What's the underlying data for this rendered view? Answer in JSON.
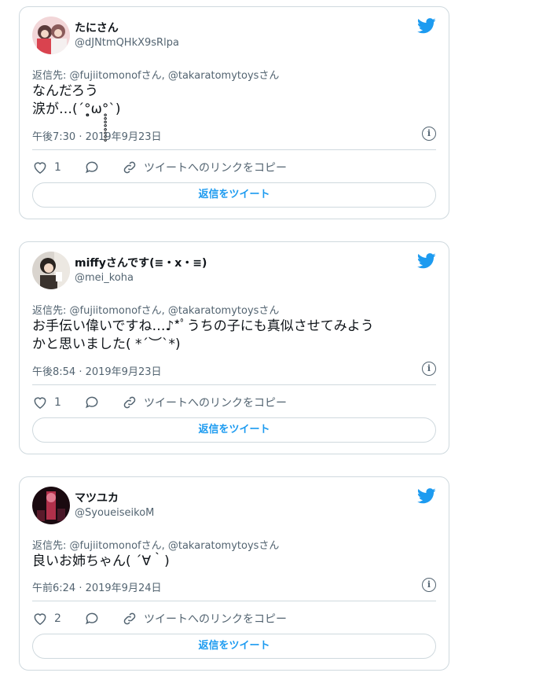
{
  "tweets": [
    {
      "name": "たにさん",
      "handle": "@dJNtmQHkX9sRlpa",
      "reply_to": "返信先: @fujiitomonofさん, @takaratomytoysさん",
      "text": "なんだろう\n涙が…(´°̥̥̥̥̥̥̥̥ω°̥̥̥̥̥̥̥̥`)",
      "time": "午後7:30 · 2019年9月23日",
      "likes": "1",
      "copy_link": "ツイートへのリンクをコピー",
      "reply_button": "返信をツイート",
      "avatar_color": "#e8b4b8"
    },
    {
      "name": "miffyさんです(≡・x・≡)",
      "handle": "@mei_koha",
      "reply_to": "返信先: @fujiitomonofさん, @takaratomytoysさん",
      "text": "お手伝い偉いですね…♪*ﾟうちの子にも真似させてみよう\nかと思いました( *´︶`*)",
      "time": "午後8:54 · 2019年9月23日",
      "likes": "1",
      "copy_link": "ツイートへのリンクをコピー",
      "reply_button": "返信をツイート",
      "avatar_color": "#c9c2bb"
    },
    {
      "name": "マツユカ",
      "handle": "@SyoueiseikoM",
      "reply_to": "返信先: @fujiitomonofさん, @takaratomytoysさん",
      "text": "良いお姉ちゃん( ´∀｀)",
      "time": "午前6:24 · 2019年9月24日",
      "likes": "2",
      "copy_link": "ツイートへのリンクをコピー",
      "reply_button": "返信をツイート",
      "avatar_color": "#3a1020"
    }
  ],
  "icons": {
    "brand": "twitter-bird-icon",
    "like": "heart-icon",
    "reply": "speech-bubble-icon",
    "link": "link-icon",
    "info": "info-icon"
  },
  "colors": {
    "accent": "#1d9bf0",
    "secondary_text": "#536471",
    "border": "#cfd9de"
  }
}
